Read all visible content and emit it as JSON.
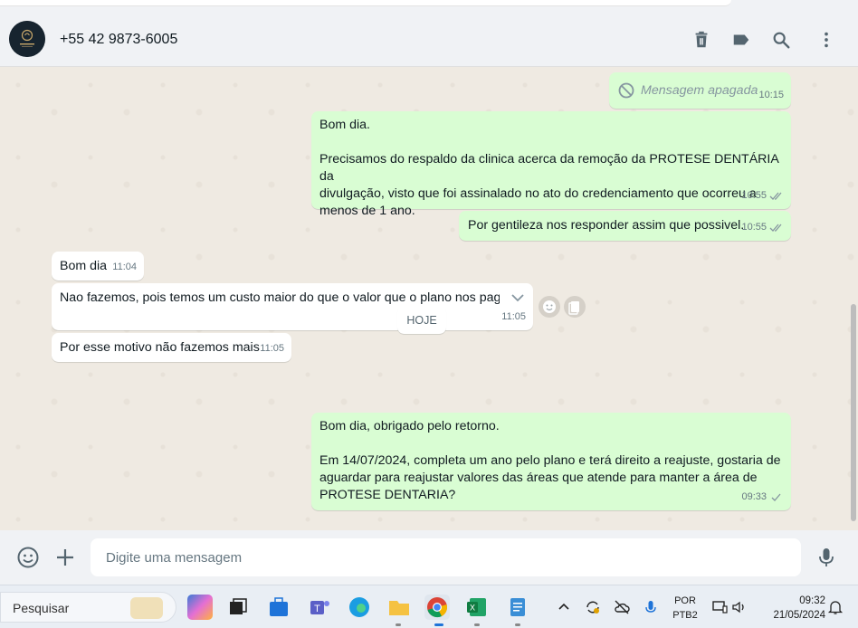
{
  "contact": {
    "phone": "+55 42 9873-6005"
  },
  "header_icons": [
    "trash-icon",
    "label-icon",
    "search-icon",
    "menu-icon"
  ],
  "messages": [
    {
      "dir": "out",
      "deleted": true,
      "text": "Mensagem apagada",
      "time": "10:15"
    },
    {
      "dir": "out",
      "lines": [
        "Bom dia.",
        "",
        "Precisamos do respaldo da clinica acerca da remoção da PROTESE DENTÁRIA da",
        "divulgação, visto que foi assinalado no ato do credenciamento que ocorreu a",
        "menos de 1 ano."
      ],
      "time": "10:55",
      "status": "read"
    },
    {
      "dir": "out",
      "text": "Por gentileza nos responder assim que possivel.",
      "time": "10:55",
      "status": "read"
    },
    {
      "dir": "in",
      "text": "Bom dia",
      "time": "11:04"
    },
    {
      "dir": "in",
      "text": "Nao fazemos, pois temos um custo maior do que o valor que o plano nos pag",
      "time": "11:05"
    },
    {
      "dir": "in",
      "text": "Por esse motivo não fazemos mais",
      "time": "11:05"
    },
    {
      "dir": "out",
      "lines": [
        "Bom dia, obrigado pelo retorno.",
        "",
        "Em 14/07/2024, completa um ano pelo plano e terá direito a reajuste, gostaria de",
        "aguardar para reajustar valores das áreas que atende para manter a área de",
        "PROTESE DENTARIA?"
      ],
      "time": "09:33",
      "status": "delivered"
    }
  ],
  "date_divider": "HOJE",
  "composer": {
    "placeholder": "Digite uma mensagem"
  },
  "taskbar": {
    "search_label": "Pesquisar",
    "language": [
      "POR",
      "PTB2"
    ],
    "time": "09:32",
    "date": "21/05/2024",
    "apps": [
      "copilot",
      "task-view",
      "store",
      "teams",
      "edge",
      "explorer",
      "chrome",
      "excel",
      "notepad"
    ]
  },
  "colors": {
    "outgoing": "#d9fdd3",
    "incoming": "#ffffff",
    "chat_bg": "#efeae2",
    "header": "#f0f2f5"
  }
}
